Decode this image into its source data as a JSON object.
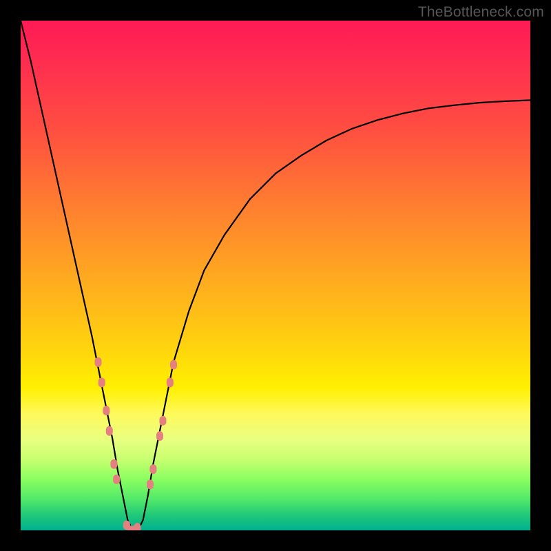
{
  "watermark": "TheBottleneck.com",
  "colors": {
    "gradient_top": "#ff1a55",
    "gradient_mid": "#fff000",
    "gradient_bottom": "#00b090",
    "curve": "#000000",
    "marker": "#e58080",
    "frame": "#000000"
  },
  "chart_data": {
    "type": "line",
    "title": "",
    "xlabel": "",
    "ylabel": "",
    "xlim": [
      0,
      100
    ],
    "ylim": [
      0,
      100
    ],
    "x": [
      0,
      2,
      4,
      6,
      8,
      10,
      12,
      14,
      15,
      16,
      17,
      18,
      19,
      20,
      21,
      22,
      23,
      24,
      25,
      26,
      27,
      28,
      30,
      33,
      36,
      40,
      45,
      50,
      55,
      60,
      65,
      70,
      75,
      80,
      85,
      90,
      95,
      100
    ],
    "y": [
      100,
      92,
      83,
      74,
      65,
      56,
      47,
      38,
      33,
      28,
      23,
      18,
      12,
      7,
      2,
      0,
      0,
      2,
      7,
      13,
      18,
      23,
      33,
      43,
      51,
      58,
      65,
      70,
      73.5,
      76.5,
      78.8,
      80.5,
      81.8,
      82.8,
      83.4,
      83.9,
      84.2,
      84.4
    ],
    "markers": [
      {
        "x": 15.2,
        "y": 33
      },
      {
        "x": 15.9,
        "y": 29
      },
      {
        "x": 16.8,
        "y": 23.5
      },
      {
        "x": 17.4,
        "y": 19.5
      },
      {
        "x": 18.3,
        "y": 13
      },
      {
        "x": 18.8,
        "y": 10
      },
      {
        "x": 20.8,
        "y": 1
      },
      {
        "x": 21.6,
        "y": 0
      },
      {
        "x": 22.3,
        "y": 0
      },
      {
        "x": 22.9,
        "y": 0.5
      },
      {
        "x": 25.4,
        "y": 9
      },
      {
        "x": 26.0,
        "y": 12
      },
      {
        "x": 27.3,
        "y": 18.5
      },
      {
        "x": 27.9,
        "y": 21.5
      },
      {
        "x": 29.3,
        "y": 29
      },
      {
        "x": 30.0,
        "y": 32.5
      }
    ]
  }
}
